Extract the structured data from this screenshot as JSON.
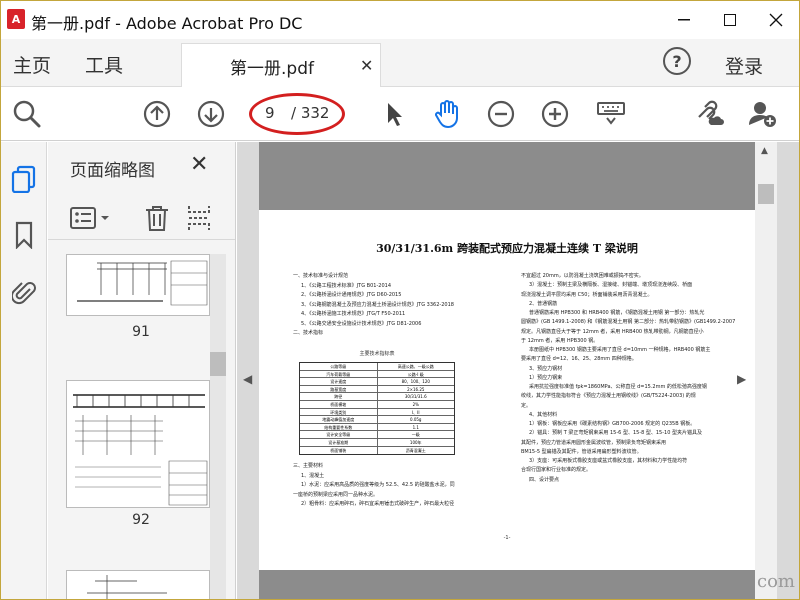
{
  "window": {
    "title": "第一册.pdf - Adobe Acrobat Pro DC",
    "app_icon_text": "A"
  },
  "menubar": {
    "home": "主页",
    "tools": "工具",
    "tab_label": "第一册.pdf",
    "login": "登录"
  },
  "toolbar": {
    "current_page": "9",
    "total_pages": "/ 332"
  },
  "thumbnails": {
    "title": "页面缩略图",
    "pages": [
      {
        "label": "91"
      },
      {
        "label": "92"
      }
    ]
  },
  "document": {
    "title": "30/31/31.6m 跨装配式预应力混凝土连续 T 梁说明",
    "left_column": [
      "一、技术标准与设计规范",
      "1、《公路工程技术标准》JTG B01-2014",
      "2、《公路桥涵设计通用规范》JTG D60-2015",
      "3、《公路钢筋混凝土及预应力混凝土桥涵设计规范》JTG 3362-2018",
      "4、《公路桥涵施工技术规范》JTG/T F50-2011",
      "5、《公路交通安全设施设计技术规范》JTG D81-2006",
      "二、技术指标"
    ],
    "table_caption": "主要技术指标表",
    "table_rows": [
      [
        "公路等级",
        "高速公路、一级公路"
      ],
      [
        "汽车荷载等级",
        "公路-I 级"
      ],
      [
        "设计速度",
        "80、100、120"
      ],
      [
        "路基宽度",
        "2×16.25"
      ],
      [
        "跨径",
        "30/31/31.6"
      ],
      [
        "桥面横坡",
        "2%"
      ],
      [
        "环境类别",
        "I、II"
      ],
      [
        "地震动峰值加速度",
        "0.05g"
      ],
      [
        "结构重要性系数",
        "1.1"
      ],
      [
        "设计安全等级",
        "一级"
      ],
      [
        "设计基准期",
        "100年"
      ],
      [
        "桥面铺装",
        "沥青混凝土"
      ]
    ],
    "left_column_2": [
      "三、主要材料",
      "1、混凝土",
      "1）水泥：应采用高品质的强度等级为 52.5、42.5 的硅酸盐水泥，同",
      "一座桥的预制梁应采用同一品种水泥。",
      "2）粗骨料：应采用碎石，碎石宜采用锤击式破碎生产，碎石最大粒径"
    ],
    "right_column": [
      "不宜超过 20mm，以防混凝土浇筑困难或振捣不密实。",
      "3）混凝土：预制主梁及横隔板、湿接缝、封锚端、墩顶现浇连续段、桥面",
      "现浇混凝土调平层均采用 C50；桥面铺装采用沥青混凝土。",
      "2、普通钢筋",
      "普通钢筋采用 HPB300 和 HRB400 钢筋，《钢筋混凝土用钢 第一部分：热轧光",
      "圆钢筋》(GB 1499.1-2008) 和《钢筋混凝土用钢 第二部分：热轧带肋钢筋》(GB1499.2-2007) 的",
      "规定。凡钢筋直径大于等于 12mm 者，采用 HRB400 热轧带肋钢，凡钢筋直径小",
      "于 12mm 者，采用 HPB300 钢。",
      "本册图纸中 HPB300 钢筋主要采用了直径 d=10mm 一种规格，HRB400 钢筋主",
      "要采用了直径 d=12、16、25、28mm 四种规格。",
      "3、预应力钢材",
      "1）预应力钢束",
      "采用抗拉强度标准值 fpk=1860MPa、公称直径 d=15.2mm 的低松弛高强度钢",
      "绞线，其力学性能指标符合《预应力混凝土用钢绞线》(GB/T5224-2003) 的规",
      "定。",
      "4、其他材料",
      "1）钢板：钢板应采用《碳素结构钢》GB700-2006 规定的 Q235B 钢板。",
      "2）锚具：预制 T 梁正弯矩钢束采用 15-6 型、15-8 型、15-10 型夹片锚具及",
      "其配件，预应力管道采用圆形金属波纹管，预制梁负弯矩钢束采用",
      "BM15-5 型扁锚及其配件，管道采用扁形塑料波纹管。",
      "3）支座：可采用板式橡胶支座或盆式橡胶支座，其材料和力学性能均符",
      "合现行国家和行业标准的规定。",
      "四、设计要点"
    ],
    "footer_page": "-1-"
  },
  "watermark": "com",
  "colors": {
    "annotation_ellipse": "#d31f1f",
    "hand_tool": "#1473e6",
    "active_rail_icon": "#1473e6",
    "app_icon": "#d8232a"
  },
  "icons": {
    "zoom": "magnifier-icon",
    "prev": "arrow-up-circle-icon",
    "next": "arrow-down-circle-icon",
    "select": "cursor-arrow-icon",
    "hand": "hand-icon",
    "zoom_out": "minus-circle-icon",
    "zoom_in": "plus-circle-icon",
    "keyboard": "keyboard-icon",
    "link": "link-cloud-icon",
    "share": "add-user-icon"
  }
}
